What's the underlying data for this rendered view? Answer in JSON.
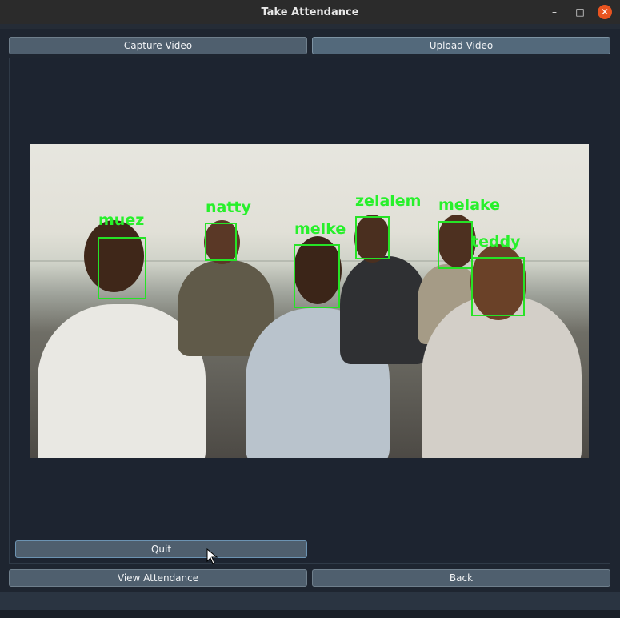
{
  "window": {
    "title": "Take Attendance",
    "controls": {
      "minimize": "–",
      "maximize": "□",
      "close": "✕"
    }
  },
  "toolbar": {
    "capture_label": "Capture Video",
    "upload_label": "Upload Video"
  },
  "video": {
    "detections": [
      {
        "name": "muez"
      },
      {
        "name": "natty"
      },
      {
        "name": "melke"
      },
      {
        "name": "zelalem"
      },
      {
        "name": "melake"
      },
      {
        "name": "teddy"
      }
    ],
    "box_color": "#26e326"
  },
  "actions": {
    "quit_label": "Quit",
    "view_attendance_label": "View Attendance",
    "back_label": "Back"
  },
  "colors": {
    "background": "#1e2530",
    "button": "#4f5f6e",
    "close_button": "#e95420"
  }
}
